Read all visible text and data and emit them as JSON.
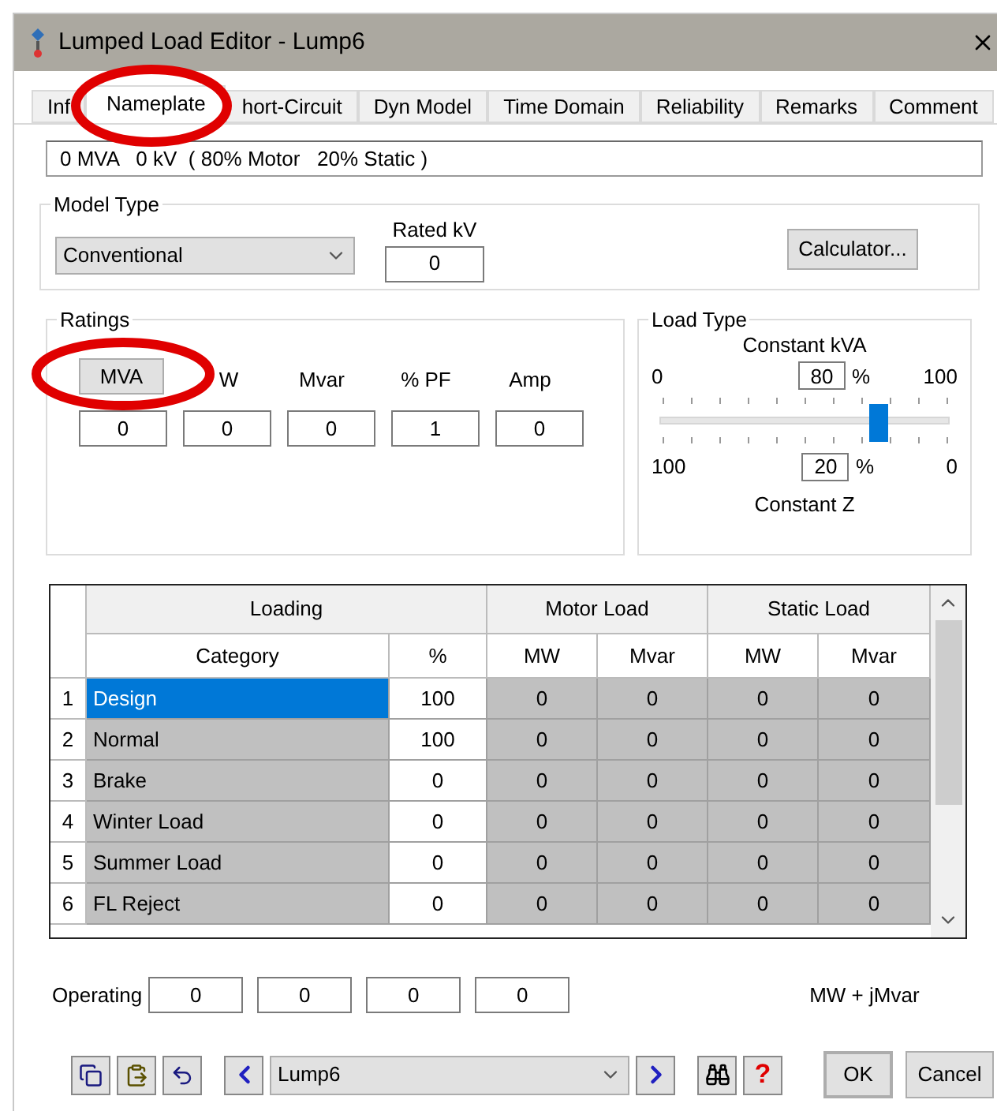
{
  "window": {
    "title": "Lumped Load Editor - Lump6"
  },
  "tabs": [
    {
      "label": "Inf",
      "selected": false
    },
    {
      "label": "Nameplate",
      "selected": true
    },
    {
      "label": "hort-Circuit",
      "selected": false
    },
    {
      "label": "Dyn Model",
      "selected": false
    },
    {
      "label": "Time Domain",
      "selected": false
    },
    {
      "label": "Reliability",
      "selected": false
    },
    {
      "label": "Remarks",
      "selected": false
    },
    {
      "label": "Comment",
      "selected": false
    }
  ],
  "summary": "0 MVA   0 kV  ( 80% Motor   20% Static )",
  "model_type": {
    "title": "Model Type",
    "value": "Conventional",
    "rated_kv_label": "Rated kV",
    "rated_kv": "0",
    "calculator": "Calculator..."
  },
  "ratings": {
    "title": "Ratings",
    "button": "MVA",
    "labels": [
      "W",
      "Mvar",
      "% PF",
      "Amp"
    ],
    "values": [
      "0",
      "0",
      "0",
      "1",
      "0"
    ]
  },
  "load_type": {
    "title": "Load Type",
    "top_label": "Constant kVA",
    "top_min": "0",
    "top_max": "100",
    "top_value": "80",
    "unit": "%",
    "level": 0.8,
    "bottom_min": "100",
    "bottom_max": "0",
    "bottom_value": "20",
    "bottom_label": "Constant Z"
  },
  "table": {
    "groups": [
      "Loading",
      "Motor Load",
      "Static Load"
    ],
    "columns": [
      "Category",
      "%",
      "MW",
      "Mvar",
      "MW",
      "Mvar"
    ],
    "rows": [
      {
        "num": "1",
        "cells": [
          "Design",
          "100",
          "0",
          "0",
          "0",
          "0"
        ],
        "selected": true
      },
      {
        "num": "2",
        "cells": [
          "Normal",
          "100",
          "0",
          "0",
          "0",
          "0"
        ],
        "selected": false
      },
      {
        "num": "3",
        "cells": [
          "Brake",
          "0",
          "0",
          "0",
          "0",
          "0"
        ],
        "selected": false
      },
      {
        "num": "4",
        "cells": [
          "Winter Load",
          "0",
          "0",
          "0",
          "0",
          "0"
        ],
        "selected": false
      },
      {
        "num": "5",
        "cells": [
          "Summer Load",
          "0",
          "0",
          "0",
          "0",
          "0"
        ],
        "selected": false
      },
      {
        "num": "6",
        "cells": [
          "FL Reject",
          "0",
          "0",
          "0",
          "0",
          "0"
        ],
        "selected": false
      }
    ]
  },
  "operating": {
    "label": "Operating",
    "values": [
      "0",
      "0",
      "0",
      "0"
    ],
    "unit": "MW + jMvar"
  },
  "footer": {
    "selector": "Lump6",
    "help": "?",
    "ok": "OK",
    "cancel": "Cancel"
  }
}
